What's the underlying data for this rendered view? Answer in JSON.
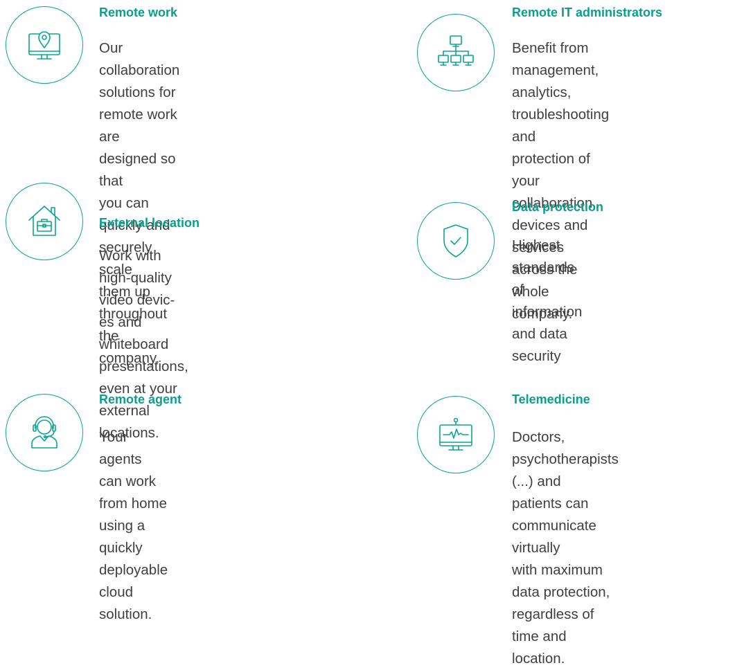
{
  "features": [
    {
      "icon": "monitor-location-pin-icon",
      "title": "Remote work",
      "text": "Our collaboration solutions for\nremote work are designed so that\nyou can quickly and securely scale\nthem up throughout the company."
    },
    {
      "icon": "network-monitors-icon",
      "title": "Remote IT administrators",
      "text": "Benefit from management,\nanalytics, troubleshooting and\nprotection of your collaboration\ndevices and services across the\nwhole company."
    },
    {
      "icon": "house-briefcase-icon",
      "title": "External location",
      "text": "Work with high-quality video devic-\nes and whiteboard presentations,\neven at your external locations."
    },
    {
      "icon": "shield-check-icon",
      "title": "Data protection",
      "text": "Highest standards of information\nand data security"
    },
    {
      "icon": "headset-agent-icon",
      "title": "Remote agent",
      "text": "Your agents can work from home\nusing a quickly deployable cloud\nsolution."
    },
    {
      "icon": "monitor-heartbeat-icon",
      "title": "Telemedicine",
      "text": "Doctors, psychotherapists (...) and\npatients can communicate virtually\nwith maximum data protection,\nregardless of time and location."
    }
  ],
  "colors": {
    "accent": "#0aa58f",
    "text": "#3f3f3f",
    "background": "#ffffff"
  }
}
